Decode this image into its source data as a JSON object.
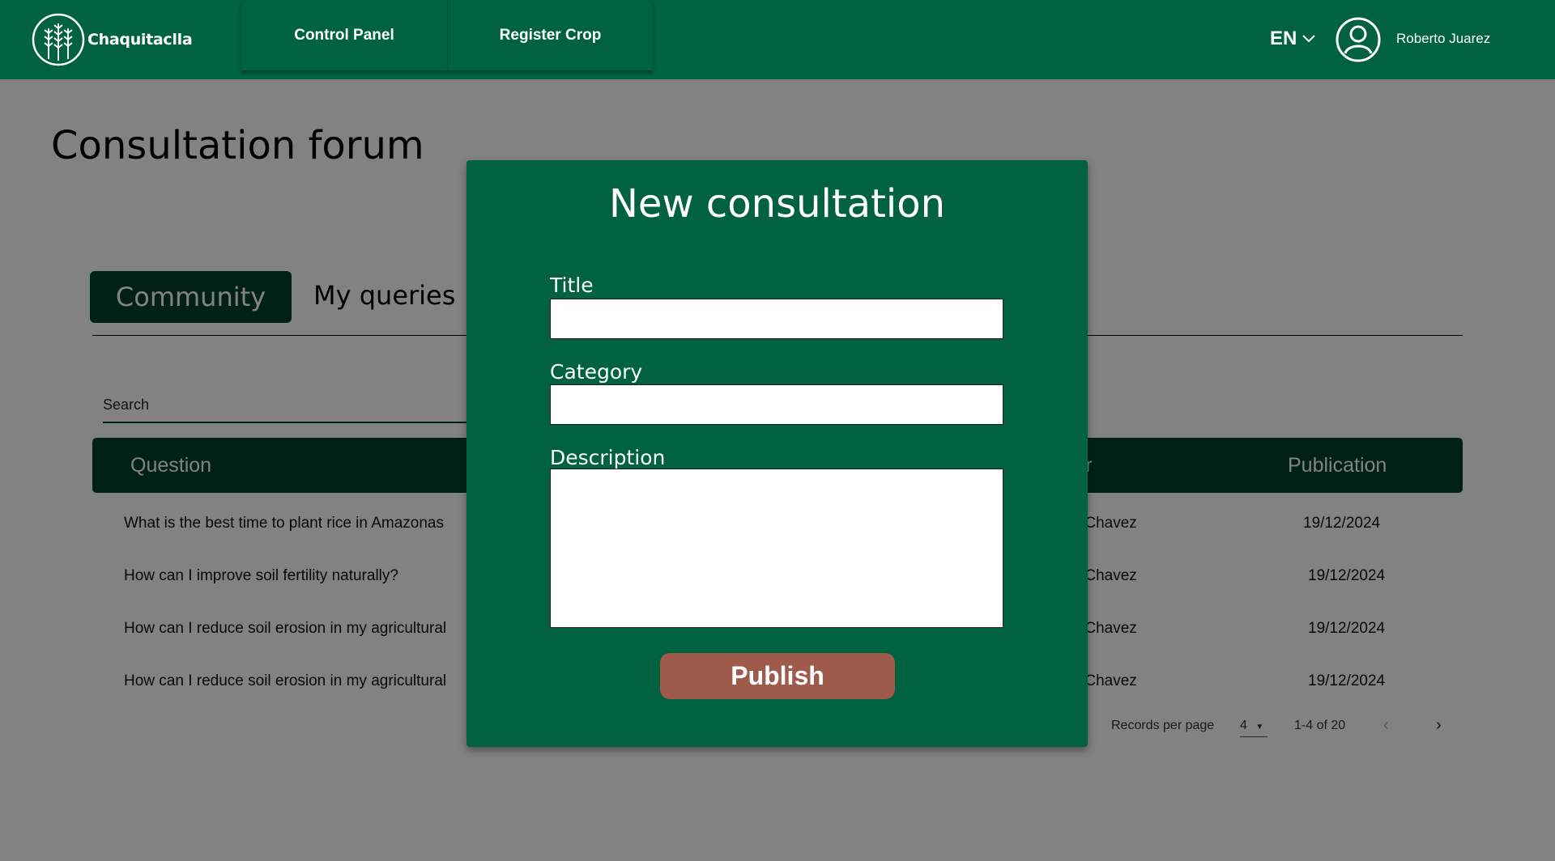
{
  "header": {
    "brand": "Chaquitaclla",
    "nav": [
      "Control Panel",
      "Register Crop"
    ],
    "language": "EN",
    "user_name": "Roberto Juarez"
  },
  "main": {
    "title": "Consultation forum",
    "tabs": [
      {
        "label": "Community",
        "active": true
      },
      {
        "label": "My queries",
        "active": false
      }
    ],
    "search_placeholder": "Search",
    "table": {
      "columns": [
        "Question",
        "ser",
        "Publication"
      ],
      "rows": [
        {
          "question": "What is the best time to plant rice in Amazonas",
          "user": "ex Chavez",
          "publication": "19/12/2024"
        },
        {
          "question": "How can I improve soil fertility naturally?",
          "user": "ex Chavez",
          "publication": "19/12/2024"
        },
        {
          "question": "How can I reduce soil erosion in my agricultural",
          "user": "ex Chavez",
          "publication": "19/12/2024"
        },
        {
          "question": "How can I reduce soil erosion in my agricultural",
          "user": "ex Chavez",
          "publication": "19/12/2024"
        }
      ]
    },
    "pagination": {
      "records_label": "Records per page",
      "per_page": "4",
      "range": "1-4 of 20",
      "prev": "‹",
      "next": "›"
    }
  },
  "modal": {
    "title": "New consultation",
    "fields": {
      "title_label": "Title",
      "title_value": "",
      "category_label": "Category",
      "category_value": "",
      "description_label": "Description",
      "description_value": ""
    },
    "publish_label": "Publish"
  },
  "colors": {
    "header_green": "#006241",
    "dark_green": "#00412b",
    "publish_button": "#9e5a4a",
    "overlay": "rgba(0,0,0,0.49)"
  },
  "icons": [
    "wheat-logo-icon",
    "chevron-down-icon",
    "user-avatar-icon",
    "chevron-left-icon",
    "chevron-right-icon",
    "dropdown-arrow-icon"
  ]
}
